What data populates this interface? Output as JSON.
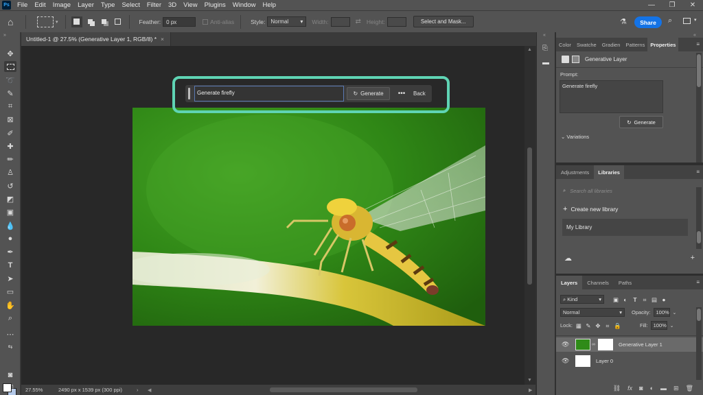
{
  "app": {
    "logo": "Ps",
    "menus": [
      "File",
      "Edit",
      "Image",
      "Layer",
      "Type",
      "Select",
      "Filter",
      "3D",
      "View",
      "Plugins",
      "Window",
      "Help"
    ],
    "window_controls": [
      "—",
      "❐",
      "✕"
    ]
  },
  "options": {
    "feather_label": "Feather:",
    "feather_value": "0 px",
    "antialias_label": "Anti-alias",
    "style_label": "Style:",
    "style_value": "Normal",
    "width_label": "Width:",
    "height_label": "Height:",
    "select_mask_label": "Select and Mask...",
    "share_label": "Share"
  },
  "document": {
    "tab_title": "Untitled-1 @ 27.5% (Generative Layer 1, RGB/8) *",
    "close_glyph": "×"
  },
  "contextual_bar": {
    "prompt_value": "Generate firefly",
    "generate_label": "Generate",
    "more_label": "•••",
    "back_label": "Back"
  },
  "status": {
    "zoom": "27.55%",
    "dimensions": "2490 px x 1539 px (300 ppi)"
  },
  "properties_panel": {
    "tabs": [
      "Color",
      "Swatche",
      "Gradien",
      "Patterns",
      "Properties"
    ],
    "active_tab": "Properties",
    "layer_type": "Generative Layer",
    "prompt_label": "Prompt:",
    "prompt_value": "Generate firefly",
    "generate_label": "Generate",
    "variations_label": "Variations"
  },
  "libraries_panel": {
    "tabs": [
      "Adjustments",
      "Libraries"
    ],
    "active_tab": "Libraries",
    "search_placeholder": "Search all libraries",
    "create_label": "Create new library",
    "library_name": "My Library"
  },
  "layers_panel": {
    "tabs": [
      "Layers",
      "Channels",
      "Paths"
    ],
    "active_tab": "Layers",
    "filter_kind": "Kind",
    "blend_mode": "Normal",
    "opacity_label": "Opacity:",
    "opacity_value": "100%",
    "lock_label": "Lock:",
    "fill_label": "Fill:",
    "fill_value": "100%",
    "layers": [
      {
        "name": "Generative Layer 1",
        "selected": true
      },
      {
        "name": "Layer 0",
        "selected": false
      }
    ]
  },
  "colors": {
    "accent": "#1473e6",
    "highlight": "#5fd4b4"
  }
}
